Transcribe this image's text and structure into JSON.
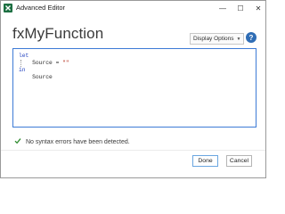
{
  "window": {
    "title": "Advanced Editor",
    "minimize_glyph": "—",
    "maximize_glyph": "☐",
    "close_glyph": "✕"
  },
  "header": {
    "title": "fxMyFunction",
    "display_options_label": "Display Options",
    "display_options_caret": "▼",
    "help_glyph": "?"
  },
  "editor": {
    "lines": [
      {
        "kw": "let",
        "ident": "",
        "str": ""
      },
      {
        "kw": "",
        "ident": "    Source = ",
        "str": "\"\""
      },
      {
        "kw": "in",
        "ident": "",
        "str": ""
      },
      {
        "kw": "",
        "ident": "    Source",
        "str": ""
      }
    ]
  },
  "status": {
    "message": "No syntax errors have been detected.",
    "icon": "check-icon"
  },
  "footer": {
    "done_label": "Done",
    "cancel_label": "Cancel"
  },
  "colors": {
    "excel_green": "#1d6f42",
    "help_blue": "#2f6db5",
    "editor_border": "#3d7bd6",
    "keyword": "#1f3fbf",
    "string": "#b5311f",
    "check_green": "#2e8b2e"
  }
}
